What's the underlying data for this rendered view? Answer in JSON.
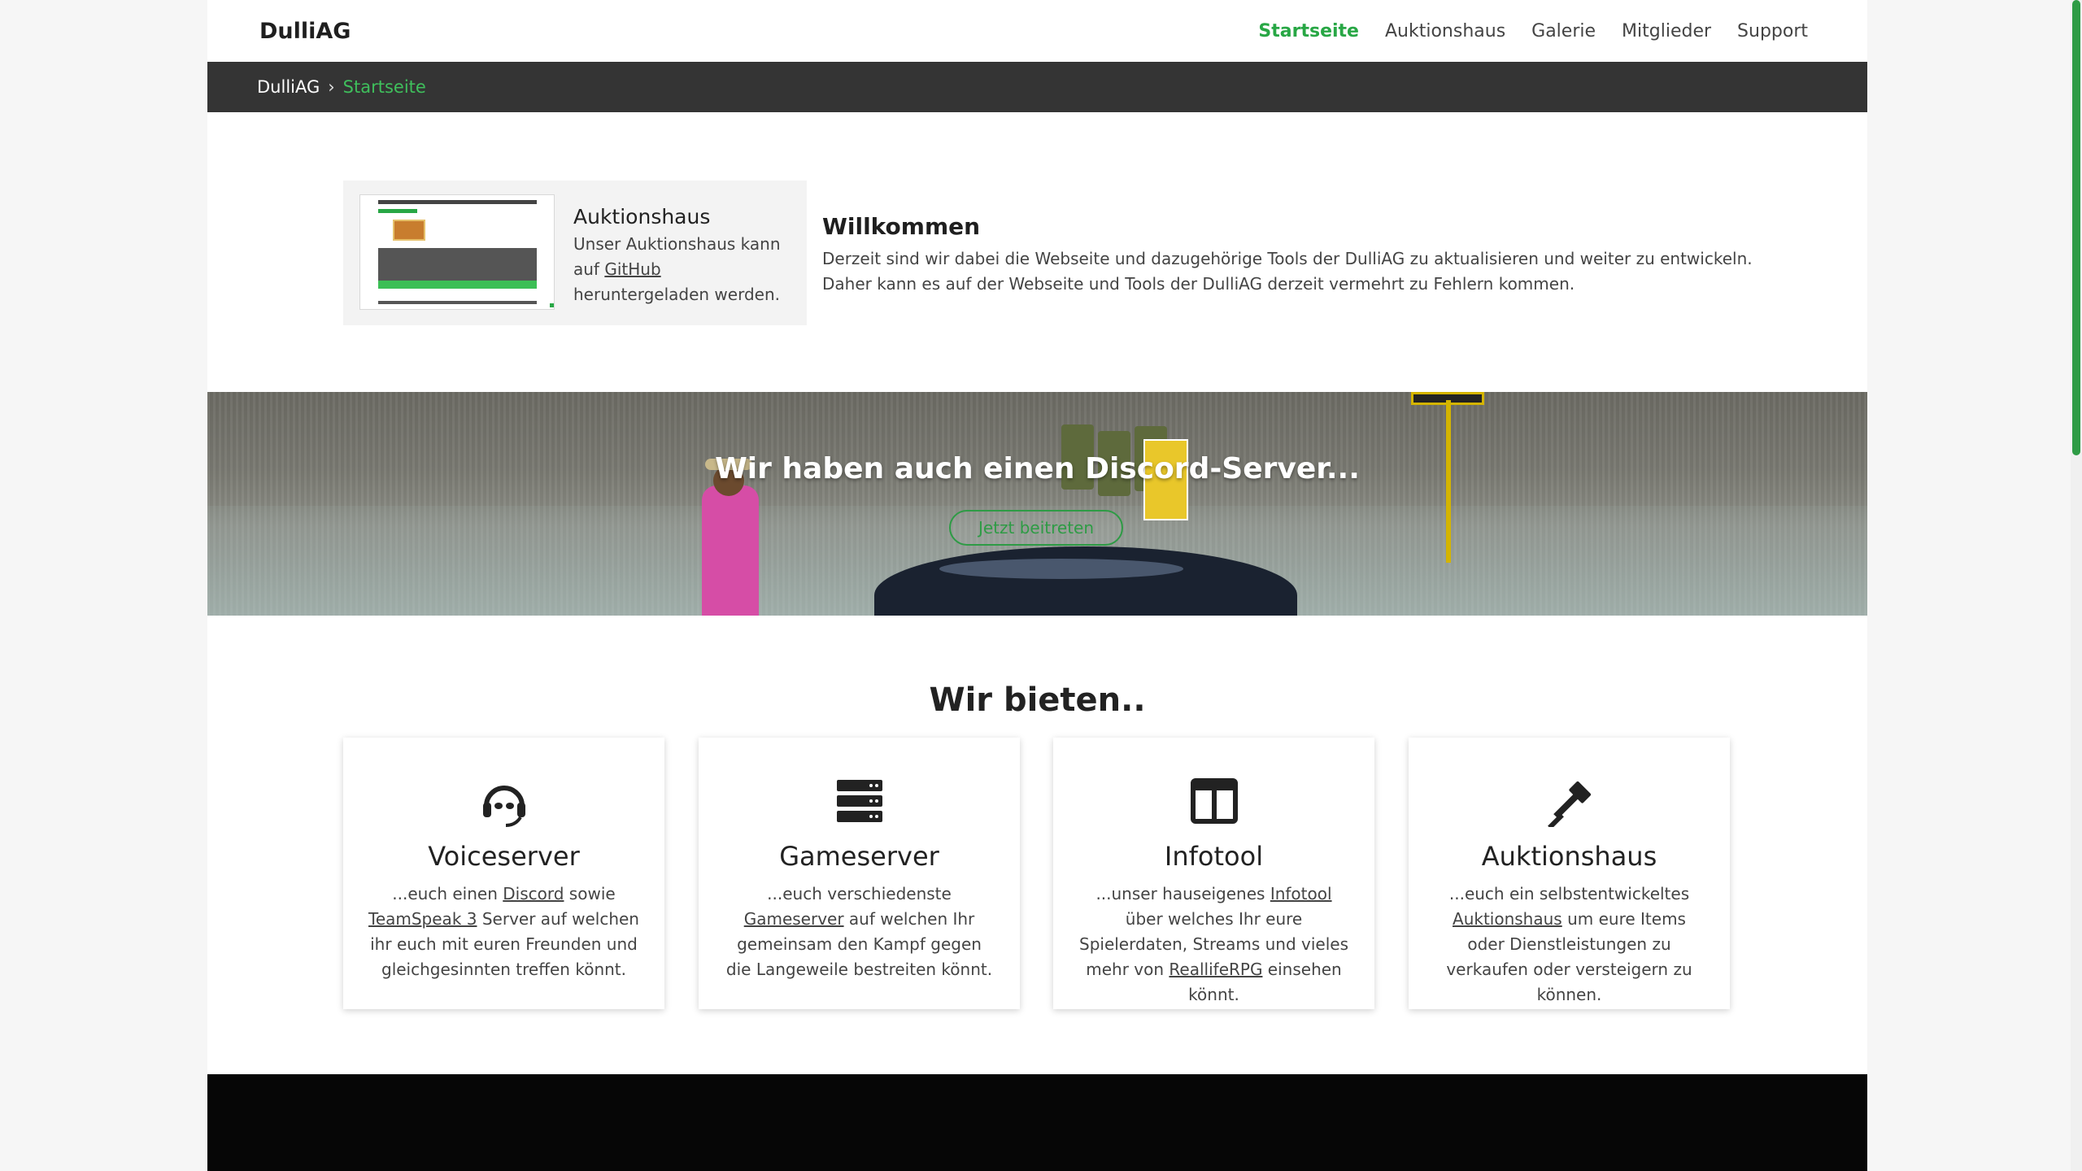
{
  "navbar": {
    "brand": "DulliAG",
    "items": [
      {
        "label": "Startseite",
        "active": true
      },
      {
        "label": "Auktionshaus",
        "active": false
      },
      {
        "label": "Galerie",
        "active": false
      },
      {
        "label": "Mitglieder",
        "active": false
      },
      {
        "label": "Support",
        "active": false
      }
    ]
  },
  "breadcrumb": {
    "root": "DulliAG",
    "separator": "›",
    "current": "Startseite"
  },
  "auktionshaus_card": {
    "title": "Auktionshaus",
    "desc_before": "Unser Auktionshaus kann auf ",
    "link": "GitHub",
    "desc_after": " heruntergeladen werden."
  },
  "welcome": {
    "title": "Willkommen",
    "line1": "Derzeit sind wir dabei die Webseite und dazugehörige Tools der DulliAG zu aktualisieren und weiter zu entwickeln.",
    "line2": "Daher kann es auf der Webseite und Tools der DulliAG derzeit vermehrt zu Fehlern kommen."
  },
  "banner": {
    "title": "Wir haben auch einen Discord-Server...",
    "button": "Jetzt beitreten"
  },
  "offers": {
    "title": "Wir bieten..",
    "cards": [
      {
        "icon": "headset-icon",
        "title": "Voiceserver",
        "t1": "...euch einen ",
        "l1": "Discord",
        "t2": " sowie ",
        "l2": "TeamSpeak 3",
        "t3": " Server auf welchen ihr euch mit euren Freunden und gleichgesinnten treffen könnt."
      },
      {
        "icon": "server-icon",
        "title": "Gameserver",
        "t1": "...euch verschiedenste ",
        "l1": "Gameserver",
        "t2": " auf welchen Ihr gemeinsam den Kampf gegen die Langeweile bestreiten könnt.",
        "l2": "",
        "t3": ""
      },
      {
        "icon": "columns-icon",
        "title": "Infotool",
        "t1": "...unser hauseigenes ",
        "l1": "Infotool",
        "t2": " über welches Ihr eure Spielerdaten, Streams und vieles mehr von ",
        "l2": "ReallifeRPG",
        "t3": " einsehen könnt."
      },
      {
        "icon": "gavel-icon",
        "title": "Auktionshaus",
        "t1": "...euch ein selbstentwickeltes ",
        "l1": "Auktionshaus",
        "t2": " um eure Items oder Dienstleistungen zu verkaufen oder versteigern zu können.",
        "l2": "",
        "t3": ""
      }
    ]
  },
  "colors": {
    "accent": "#28a745",
    "breadcrumb_bg": "#343434",
    "footer_bg": "#060606"
  }
}
